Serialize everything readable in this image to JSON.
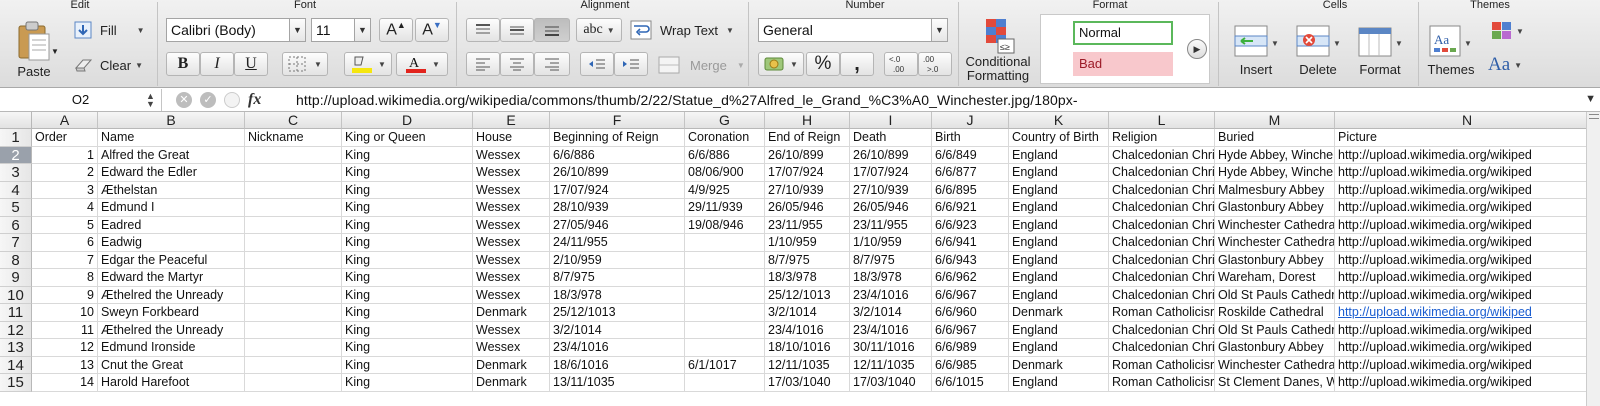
{
  "ribbon": {
    "groups": {
      "edit": "Edit",
      "font": "Font",
      "alignment": "Alignment",
      "number": "Number",
      "format": "Format",
      "cells": "Cells",
      "themes": "Themes"
    },
    "paste": "Paste",
    "fill": "Fill",
    "clear": "Clear",
    "font_name": "Calibri (Body)",
    "font_size": "11",
    "bold": "B",
    "italic": "I",
    "underline": "U",
    "wrap_text": "Wrap Text",
    "merge": "Merge",
    "orientation": "abc",
    "number_format": "General",
    "percent": "%",
    "comma": ",",
    "conditional_formatting_line1": "Conditional",
    "conditional_formatting_line2": "Formatting",
    "style_normal": "Normal",
    "style_bad": "Bad",
    "insert": "Insert",
    "delete": "Delete",
    "format_btn": "Format",
    "themes_btn": "Themes",
    "aa": "Aa"
  },
  "formula_bar": {
    "name_box": "O2",
    "fx": "fx",
    "content": "http://upload.wikimedia.org/wikipedia/commons/thumb/2/22/Statue_d%27Alfred_le_Grand_%C3%A0_Winchester.jpg/180px-"
  },
  "columns": [
    "A",
    "B",
    "C",
    "D",
    "E",
    "F",
    "G",
    "H",
    "I",
    "J",
    "K",
    "L",
    "M",
    "N"
  ],
  "rows": [
    {
      "n": "1",
      "c": [
        "Order",
        "Name",
        "Nickname",
        "King or Queen",
        "House",
        "Beginning of Reign",
        "Coronation",
        "End of Reign",
        "Death",
        "Birth",
        "Country of Birth",
        "Religion",
        "Buried",
        "Picture"
      ]
    },
    {
      "n": "2",
      "c": [
        "1",
        "Alfred the Great",
        "",
        "King",
        "Wessex",
        "6/6/886",
        "6/6/886",
        "26/10/899",
        "26/10/899",
        "6/6/849",
        "England",
        "Chalcedonian Chri",
        "Hyde Abbey, Winche",
        "http://upload.wikimedia.org/wikiped"
      ]
    },
    {
      "n": "3",
      "c": [
        "2",
        "Edward the Edler",
        "",
        "King",
        "Wessex",
        "26/10/899",
        "08/06/900",
        "17/07/924",
        "17/07/924",
        "6/6/877",
        "England",
        "Chalcedonian Chri",
        "Hyde Abbey, Winche",
        "http://upload.wikimedia.org/wikiped"
      ]
    },
    {
      "n": "4",
      "c": [
        "3",
        "Æthelstan",
        "",
        "King",
        "Wessex",
        "17/07/924",
        "4/9/925",
        "27/10/939",
        "27/10/939",
        "6/6/895",
        "England",
        "Chalcedonian Chri",
        "Malmesbury Abbey",
        "http://upload.wikimedia.org/wikiped"
      ]
    },
    {
      "n": "5",
      "c": [
        "4",
        "Edmund I",
        "",
        "King",
        "Wessex",
        "28/10/939",
        "29/11/939",
        "26/05/946",
        "26/05/946",
        "6/6/921",
        "England",
        "Chalcedonian Chri",
        "Glastonbury Abbey",
        "http://upload.wikimedia.org/wikiped"
      ]
    },
    {
      "n": "6",
      "c": [
        "5",
        "Eadred",
        "",
        "King",
        "Wessex",
        "27/05/946",
        "19/08/946",
        "23/11/955",
        "23/11/955",
        "6/6/923",
        "England",
        "Chalcedonian Chri",
        "Winchester Cathedra",
        "http://upload.wikimedia.org/wikiped"
      ]
    },
    {
      "n": "7",
      "c": [
        "6",
        "Eadwig",
        "",
        "King",
        "Wessex",
        "24/11/955",
        "",
        "1/10/959",
        "1/10/959",
        "6/6/941",
        "England",
        "Chalcedonian Chri",
        "Winchester Cathedra",
        "http://upload.wikimedia.org/wikiped"
      ]
    },
    {
      "n": "8",
      "c": [
        "7",
        "Edgar the Peaceful",
        "",
        "King",
        "Wessex",
        "2/10/959",
        "",
        "8/7/975",
        "8/7/975",
        "6/6/943",
        "England",
        "Chalcedonian Chri",
        "Glastonbury Abbey",
        "http://upload.wikimedia.org/wikiped"
      ]
    },
    {
      "n": "9",
      "c": [
        "8",
        "Edward the Martyr",
        "",
        "King",
        "Wessex",
        "8/7/975",
        "",
        "18/3/978",
        "18/3/978",
        "6/6/962",
        "England",
        "Chalcedonian Chri",
        "Wareham, Dorest",
        "http://upload.wikimedia.org/wikiped"
      ]
    },
    {
      "n": "10",
      "c": [
        "9",
        "Æthelred the Unready",
        "",
        "King",
        "Wessex",
        "18/3/978",
        "",
        "25/12/1013",
        "23/4/1016",
        "6/6/967",
        "England",
        "Chalcedonian Chri",
        "Old St Pauls Cathedra",
        "http://upload.wikimedia.org/wikiped"
      ]
    },
    {
      "n": "11",
      "c": [
        "10",
        "Sweyn Forkbeard",
        "",
        "King",
        "Denmark",
        "25/12/1013",
        "",
        "3/2/1014",
        "3/2/1014",
        "6/6/960",
        "Denmark",
        "Roman Catholicisr",
        "Roskilde Cathedral",
        "http://upload.wikimedia.org/wikiped"
      ]
    },
    {
      "n": "12",
      "c": [
        "11",
        "Æthelred the Unready",
        "",
        "King",
        "Wessex",
        "3/2/1014",
        "",
        "23/4/1016",
        "23/4/1016",
        "6/6/967",
        "England",
        "Chalcedonian Chri",
        "Old St Pauls Cathedra",
        "http://upload.wikimedia.org/wikiped"
      ]
    },
    {
      "n": "13",
      "c": [
        "12",
        "Edmund Ironside",
        "",
        "King",
        "Wessex",
        "23/4/1016",
        "",
        "18/10/1016",
        "30/11/1016",
        "6/6/989",
        "England",
        "Chalcedonian Chri",
        "Glastonbury Abbey",
        "http://upload.wikimedia.org/wikiped"
      ]
    },
    {
      "n": "14",
      "c": [
        "13",
        "Cnut the Great",
        "",
        "King",
        "Denmark",
        "18/6/1016",
        "6/1/1017",
        "12/11/1035",
        "12/11/1035",
        "6/6/985",
        "Denmark",
        "Roman Catholicisr",
        "Winchester Cathedra",
        "http://upload.wikimedia.org/wikiped"
      ]
    },
    {
      "n": "15",
      "c": [
        "14",
        "Harold Harefoot",
        "",
        "King",
        "Denmark",
        "13/11/1035",
        "",
        "17/03/1040",
        "17/03/1040",
        "6/6/1015",
        "England",
        "Roman Catholicisr",
        "St Clement Danes, W",
        "http://upload.wikimedia.org/wikiped"
      ]
    }
  ],
  "colors": {
    "selection": "#2b6cc4",
    "link": "#1a5dd0",
    "bad_fill": "#f8c8cc",
    "normal_border": "#5bb85b"
  }
}
